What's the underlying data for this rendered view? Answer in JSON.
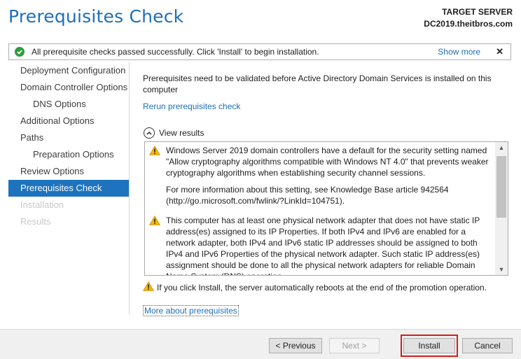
{
  "header": {
    "title": "Prerequisites Check",
    "target_label": "TARGET SERVER",
    "target_server": "DC2019.theitbros.com"
  },
  "notice": {
    "text": "All prerequisite checks passed successfully.  Click 'Install' to begin installation.",
    "show_more": "Show more",
    "close": "✕"
  },
  "nav": {
    "items": [
      {
        "label": "Deployment Configuration"
      },
      {
        "label": "Domain Controller Options"
      },
      {
        "label": "DNS Options"
      },
      {
        "label": "Additional Options"
      },
      {
        "label": "Paths"
      },
      {
        "label": "Preparation Options"
      },
      {
        "label": "Review Options"
      },
      {
        "label": "Prerequisites Check"
      },
      {
        "label": "Installation"
      },
      {
        "label": "Results"
      }
    ]
  },
  "main": {
    "intro": "Prerequisites need to be validated before Active Directory Domain Services is installed on this computer",
    "rerun": "Rerun prerequisites check",
    "view_results": "View results",
    "results": [
      {
        "p1": "Windows Server 2019 domain controllers have a default for the security setting named \"Allow cryptography algorithms compatible with Windows NT 4.0\" that prevents weaker cryptography algorithms when establishing security channel sessions.",
        "p2": "For more information about this setting, see Knowledge Base article 942564 (http://go.microsoft.com/fwlink/?LinkId=104751)."
      },
      {
        "p1": "This computer has at least one physical network adapter that does not have static IP address(es) assigned to its IP Properties. If both IPv4 and IPv6 are enabled for a network adapter, both IPv4 and IPv6 static IP addresses should be assigned to both IPv4 and IPv6 Properties of the physical network adapter. Such static IP address(es) assignment should be done to all the physical network adapters for reliable Domain Name System (DNS) operation."
      }
    ],
    "reboot_warning": "If you click Install, the server automatically reboots at the end of the promotion operation.",
    "more_about": "More about prerequisites"
  },
  "footer": {
    "previous": "< Previous",
    "next": "Next >",
    "install": "Install",
    "cancel": "Cancel"
  },
  "colors": {
    "accent": "#1e73be",
    "title": "#1d6fb8",
    "success": "#2e9e3e",
    "warning": "#f2b70c",
    "highlight": "#d11f1f"
  }
}
